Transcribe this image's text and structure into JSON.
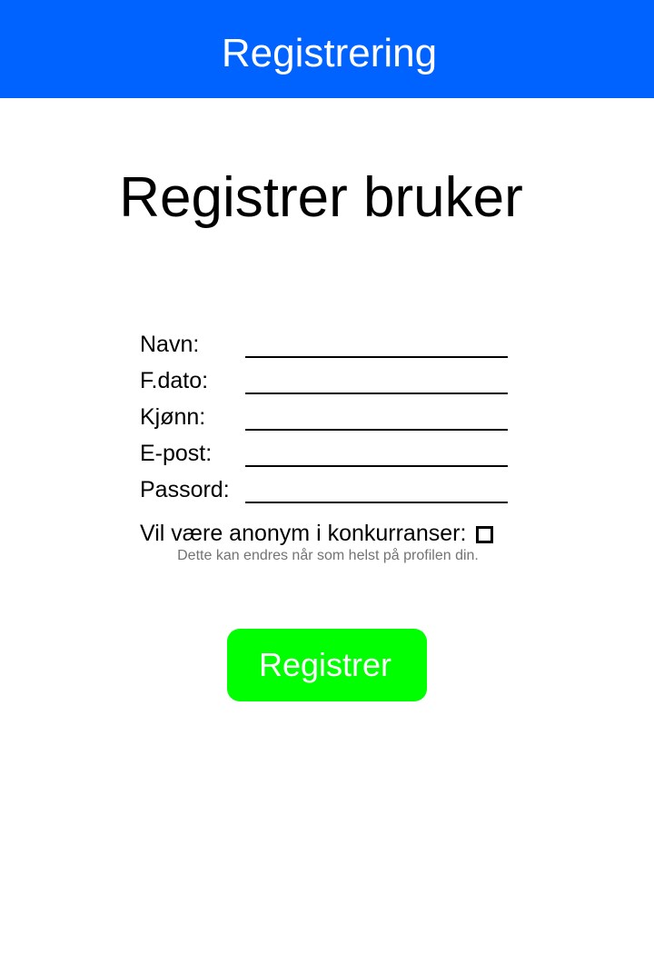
{
  "header": {
    "title": "Registrering",
    "color": "#0062ff"
  },
  "page": {
    "title": "Registrer bruker"
  },
  "form": {
    "fields": [
      {
        "label": "Navn:",
        "value": ""
      },
      {
        "label": "F.dato:",
        "value": ""
      },
      {
        "label": "Kjønn:",
        "value": ""
      },
      {
        "label": "E-post:",
        "value": ""
      },
      {
        "label": "Passord:",
        "value": ""
      }
    ],
    "anonymous": {
      "label": "Vil være anonym i konkurranser:",
      "checked": false
    },
    "hint": "Dette kan endres når som helst på profilen din."
  },
  "actions": {
    "register_label": "Registrer",
    "register_color": "#00ff00"
  }
}
